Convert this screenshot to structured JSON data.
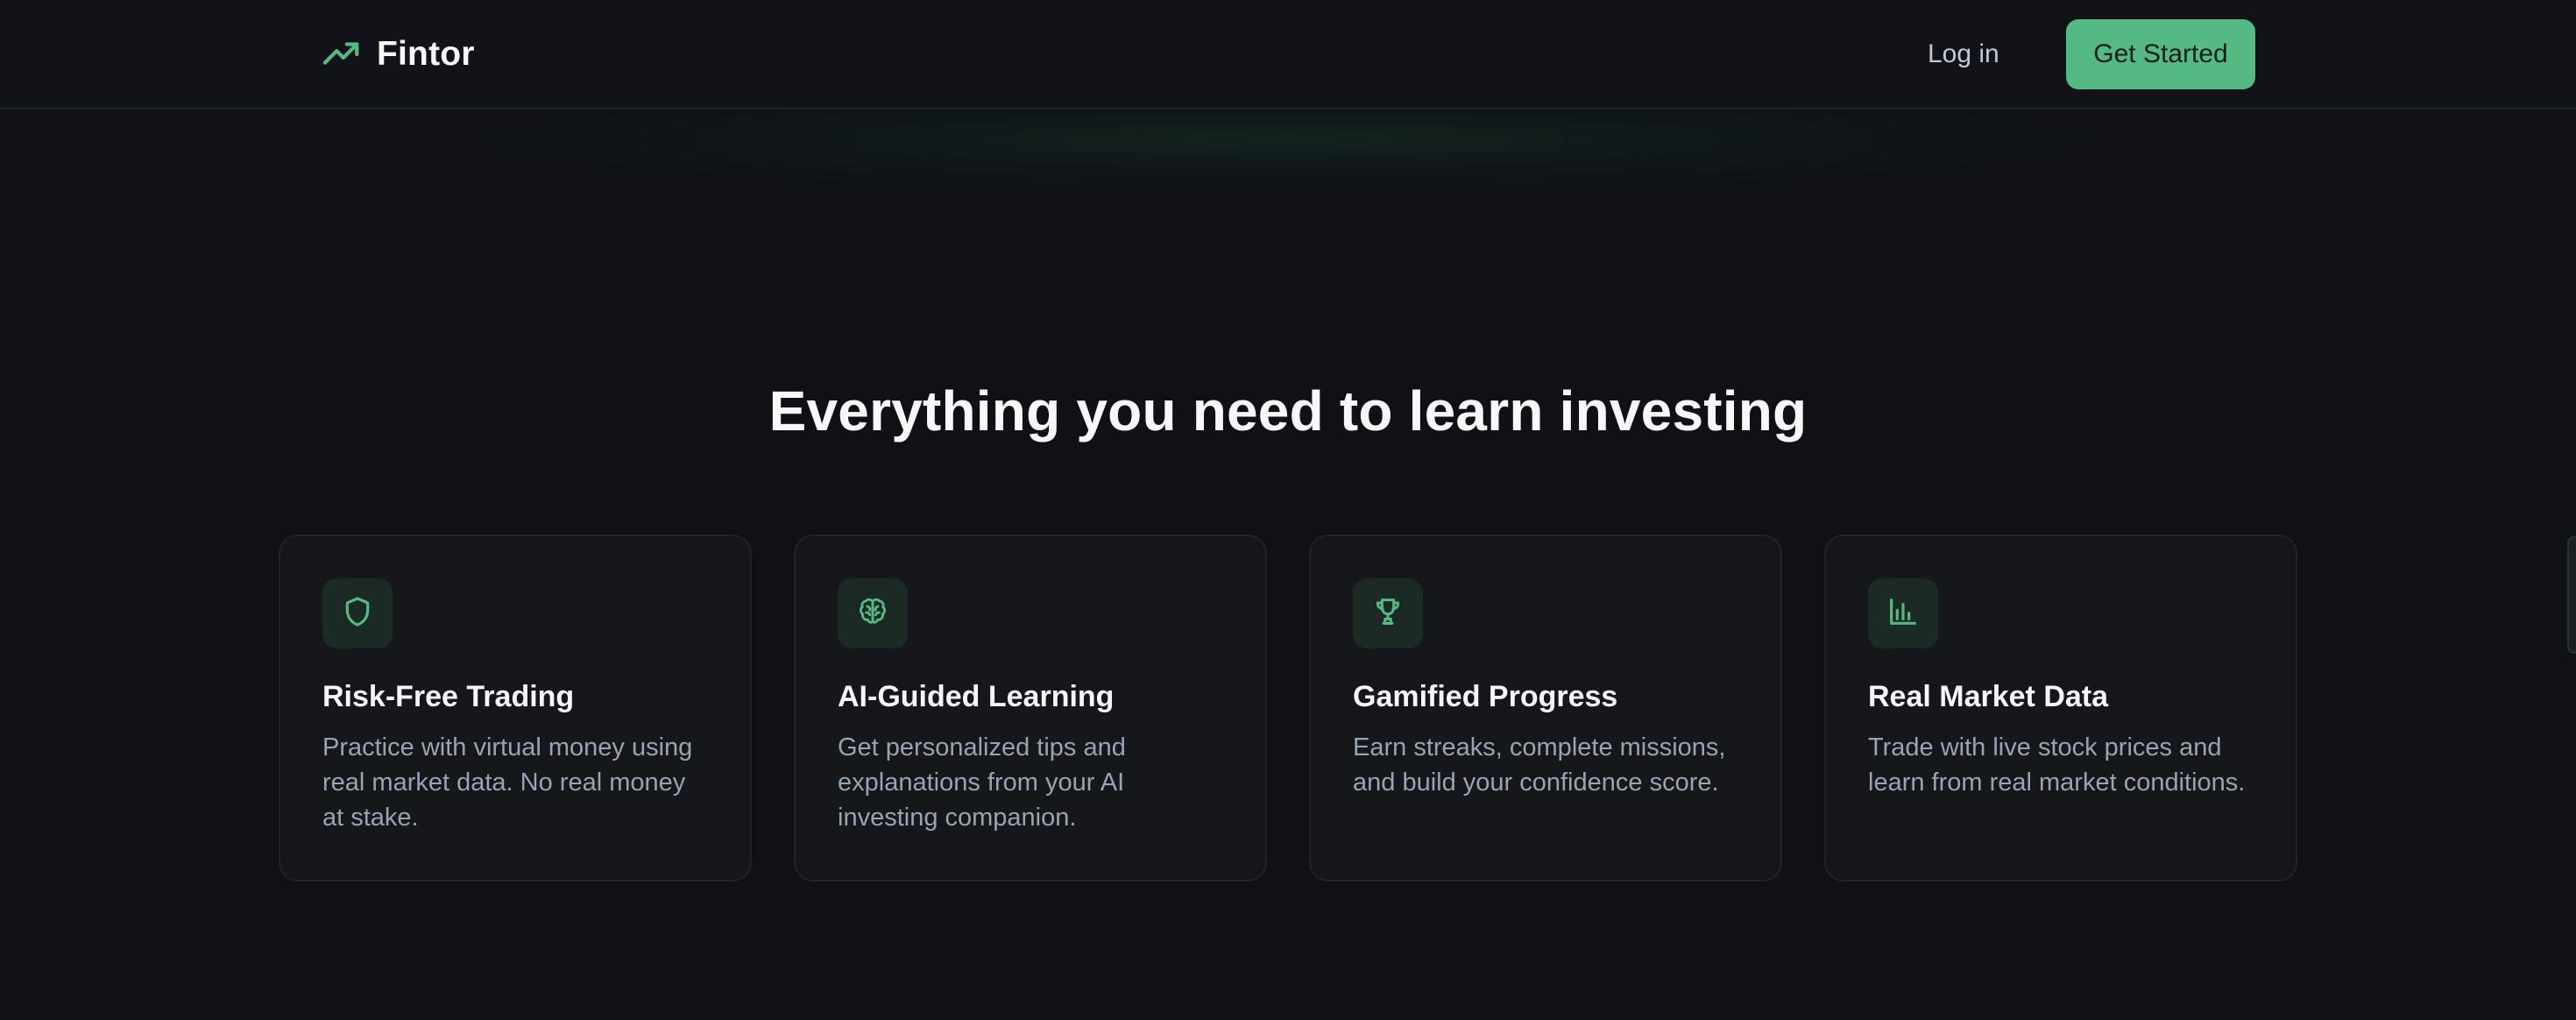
{
  "brand": {
    "name": "Fintor",
    "icon": "trending-up-icon",
    "accent_color": "#54b983"
  },
  "nav": {
    "login_label": "Log in",
    "cta_label": "Get Started"
  },
  "section": {
    "title": "Everything you need to learn investing"
  },
  "features": [
    {
      "icon": "shield-icon",
      "title": "Risk-Free Trading",
      "description": "Practice with virtual money using real market data. No real money at stake."
    },
    {
      "icon": "brain-icon",
      "title": "AI-Guided Learning",
      "description": "Get personalized tips and explanations from your AI investing companion."
    },
    {
      "icon": "trophy-icon",
      "title": "Gamified Progress",
      "description": "Earn streaks, complete missions, and build your confidence score."
    },
    {
      "icon": "bar-chart-icon",
      "title": "Real Market Data",
      "description": "Trade with live stock prices and learn from real market conditions."
    }
  ]
}
